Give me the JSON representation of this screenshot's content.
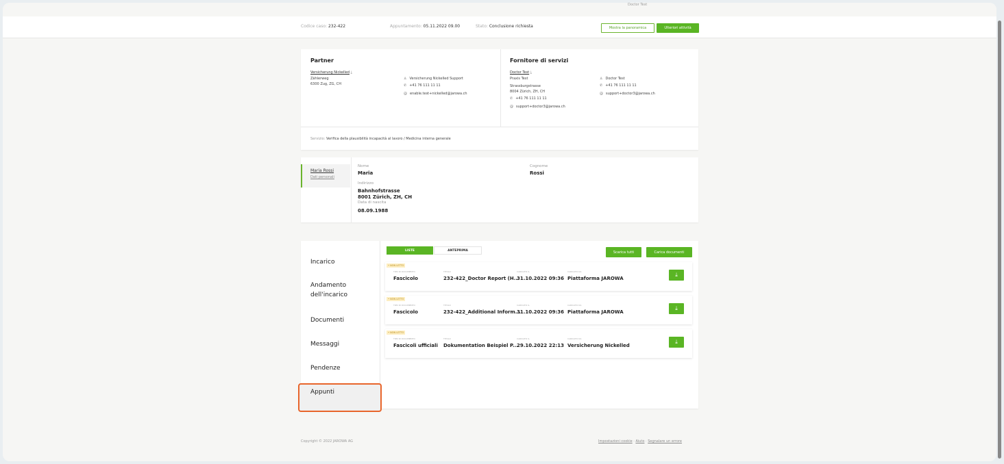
{
  "topbar": {
    "user": "Doctor Test"
  },
  "header": {
    "case_label": "Codice caso:",
    "case_value": "232-422",
    "appt_label": "Appuntamento:",
    "appt_value": "05.11.2022 09.00",
    "status_label": "Stato:",
    "status_value": "Conclusione richiesta",
    "overview_btn": "Mostra la panoramica",
    "more_btn": "Ulteriori attività"
  },
  "partner": {
    "title": "Partner",
    "name": "Versicherung Nickelled",
    "street": "Zählerweg",
    "city": "6300 Zug, ZG, CH",
    "contact_name": "Versicherung Nickelled Support",
    "phone": "+41 76 111 11 11",
    "email": "enable.test+nickelled@jarowa.ch"
  },
  "provider": {
    "title": "Fornitore di servizi",
    "name": "Doctor Test",
    "practice": "Praxis Test",
    "street": "Strassburgstrasse",
    "city": "8004 Zürich, ZH, CH",
    "phone": "+41 76 111 11 11",
    "email": "support+doctor3@jarowa.ch",
    "contact_name": "Doctor Test",
    "contact_phone": "+41 76 111 11 11",
    "contact_email": "support+doctor3@jarowa.ch"
  },
  "service": {
    "label": "Servizio:",
    "value": "Verifica della plausibilità incapacità al lavoro / Medicina interna generale"
  },
  "person": {
    "tab_name": "Maria Rossi",
    "tab_sub": "Dati personali",
    "first_label": "Nome",
    "first_value": "Maria",
    "last_label": "Cognome",
    "last_value": "Rossi",
    "address_label": "Indirizzo",
    "address_line1": "Bahnhofstrasse",
    "address_line2": "8001 Zürich, ZH, CH",
    "dob_label": "Data di nascita",
    "dob_value": "08.09.1988"
  },
  "nav": {
    "items": [
      "Incarico",
      "Andamento dell'incarico",
      "Documenti",
      "Messaggi",
      "Pendenze",
      "Appunti"
    ]
  },
  "docs": {
    "tab_list": "LISTE",
    "tab_preview": "ANTEPRIMA",
    "download_all": "Scarica tutti",
    "upload": "Carica documenti",
    "col_type": "TIPO DI DOCUMENTO",
    "col_title": "TITOLO",
    "col_uploaded": "CARICATO IL",
    "col_by": "CARICATO DA",
    "unread": "• NON LETTO",
    "rows": [
      {
        "type": "Fascicolo",
        "title": "232-422_Doctor Report (H...",
        "date": "31.10.2022 09:36",
        "by": "Piattaforma JAROWA"
      },
      {
        "type": "Fascicolo",
        "title": "232-422_Additional Inform...",
        "date": "31.10.2022 09:36",
        "by": "Piattaforma JAROWA"
      },
      {
        "type": "Fascicoli ufficiali",
        "title": "Dokumentation Beispiel P...",
        "date": "29.10.2022 22:13",
        "by": "Versicherung Nickelled"
      }
    ]
  },
  "footer": {
    "copyright": "Copyright © 2022 JAROWA AG",
    "cookie": "Impostazioni cookie",
    "help": "Aiuto",
    "report": "Segnalare un errore",
    "sep": "·"
  },
  "icons": {
    "person": "person-icon",
    "phone": "phone-icon",
    "email": "at-icon",
    "download": "download-icon"
  },
  "colors": {
    "accent": "#5ab524",
    "highlight": "#e8642a",
    "badge": "#fdeec2"
  }
}
